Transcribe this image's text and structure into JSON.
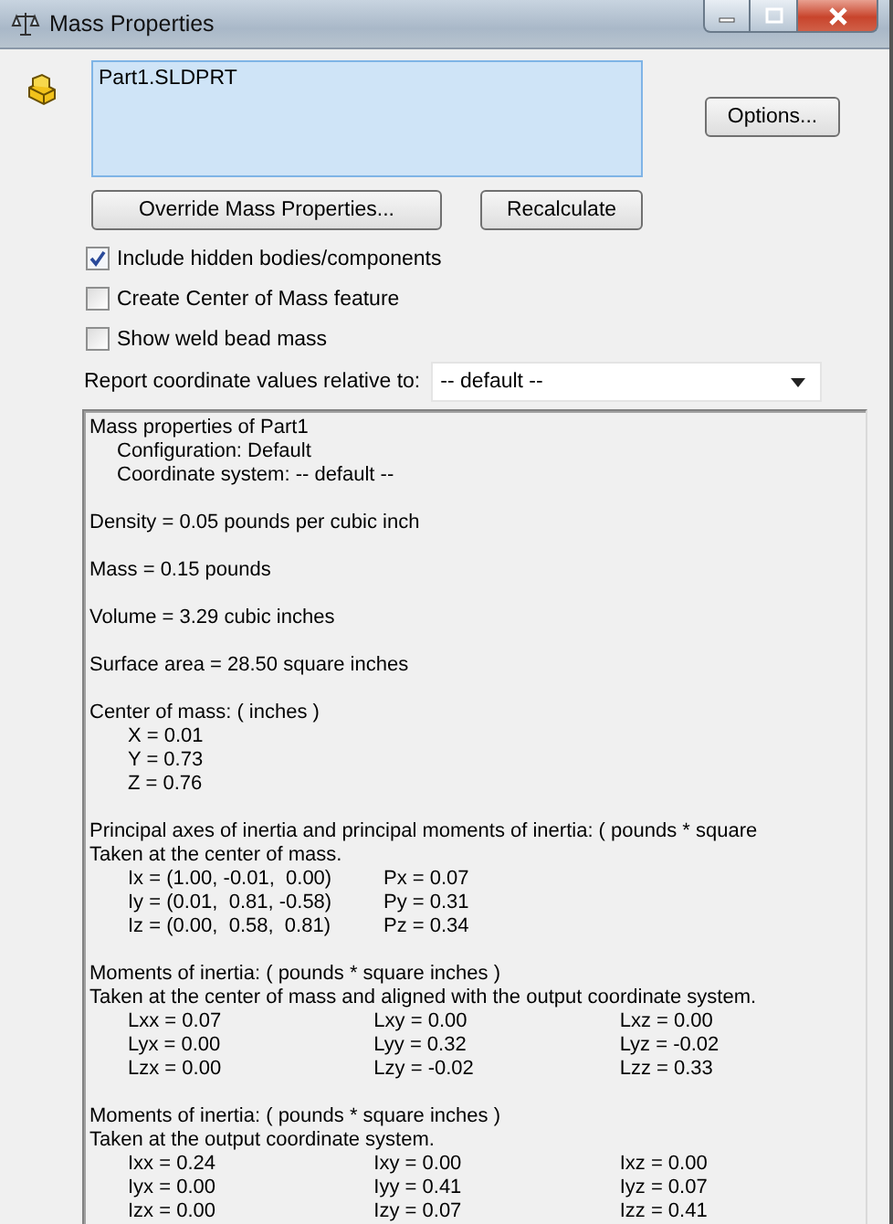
{
  "window": {
    "title": "Mass Properties"
  },
  "selection": {
    "items": [
      "Part1.SLDPRT"
    ]
  },
  "buttons": {
    "options": "Options...",
    "override": "Override Mass Properties...",
    "recalculate": "Recalculate"
  },
  "checkboxes": [
    {
      "label": "Include hidden bodies/components",
      "checked": true
    },
    {
      "label": "Create Center of Mass feature",
      "checked": false
    },
    {
      "label": "Show weld bead mass",
      "checked": false
    }
  ],
  "coordinate": {
    "label": "Report coordinate values relative to:",
    "value": "-- default --"
  },
  "report": {
    "sections": [
      {
        "lines": [
          {
            "kind": "text",
            "text": "Mass properties of Part1"
          },
          {
            "kind": "indent",
            "text": "Configuration: Default"
          },
          {
            "kind": "indent",
            "text": "Coordinate system: -- default --"
          }
        ]
      },
      {
        "lines": [
          {
            "kind": "text",
            "text": "Density = 0.05 pounds per cubic inch"
          }
        ]
      },
      {
        "lines": [
          {
            "kind": "text",
            "text": "Mass = 0.15 pounds"
          }
        ]
      },
      {
        "lines": [
          {
            "kind": "text",
            "text": "Volume = 3.29 cubic inches"
          }
        ]
      },
      {
        "lines": [
          {
            "kind": "text",
            "text": "Surface area = 28.50 square inches"
          }
        ]
      },
      {
        "lines": [
          {
            "kind": "text",
            "text": "Center of mass: ( inches )"
          },
          {
            "kind": "value",
            "text": "X = 0.01"
          },
          {
            "kind": "value",
            "text": "Y = 0.73"
          },
          {
            "kind": "value",
            "text": "Z = 0.76"
          }
        ]
      },
      {
        "lines": [
          {
            "kind": "text",
            "text": "Principal axes of inertia and principal moments of inertia: ( pounds * square"
          },
          {
            "kind": "text",
            "text": "Taken at the center of mass."
          },
          {
            "kind": "row",
            "cells": [
              "Ix = (1.00, -0.01,  0.00)",
              "Px = 0.07"
            ]
          },
          {
            "kind": "row",
            "cells": [
              "Iy = (0.01,  0.81, -0.58)",
              "Py = 0.31"
            ]
          },
          {
            "kind": "row",
            "cells": [
              "Iz = (0.00,  0.58,  0.81)",
              "Pz = 0.34"
            ]
          }
        ]
      },
      {
        "lines": [
          {
            "kind": "text",
            "text": "Moments of inertia: ( pounds * square inches )"
          },
          {
            "kind": "text",
            "text": "Taken at the center of mass and aligned with the output coordinate system."
          },
          {
            "kind": "row",
            "cells": [
              "Lxx = 0.07",
              "Lxy = 0.00",
              "Lxz = 0.00"
            ]
          },
          {
            "kind": "row",
            "cells": [
              "Lyx = 0.00",
              "Lyy = 0.32",
              "Lyz = -0.02"
            ]
          },
          {
            "kind": "row",
            "cells": [
              "Lzx = 0.00",
              "Lzy = -0.02",
              "Lzz = 0.33"
            ]
          }
        ]
      },
      {
        "lines": [
          {
            "kind": "text",
            "text": "Moments of inertia: ( pounds * square inches )"
          },
          {
            "kind": "text",
            "text": "Taken at the output coordinate system."
          },
          {
            "kind": "row",
            "cells": [
              "Ixx = 0.24",
              "Ixy = 0.00",
              "Ixz = 0.00"
            ]
          },
          {
            "kind": "row",
            "cells": [
              "Iyx = 0.00",
              "Iyy = 0.41",
              "Iyz = 0.07"
            ]
          },
          {
            "kind": "row",
            "cells": [
              "Izx = 0.00",
              "Izy = 0.07",
              "Izz = 0.41"
            ]
          }
        ]
      }
    ]
  }
}
